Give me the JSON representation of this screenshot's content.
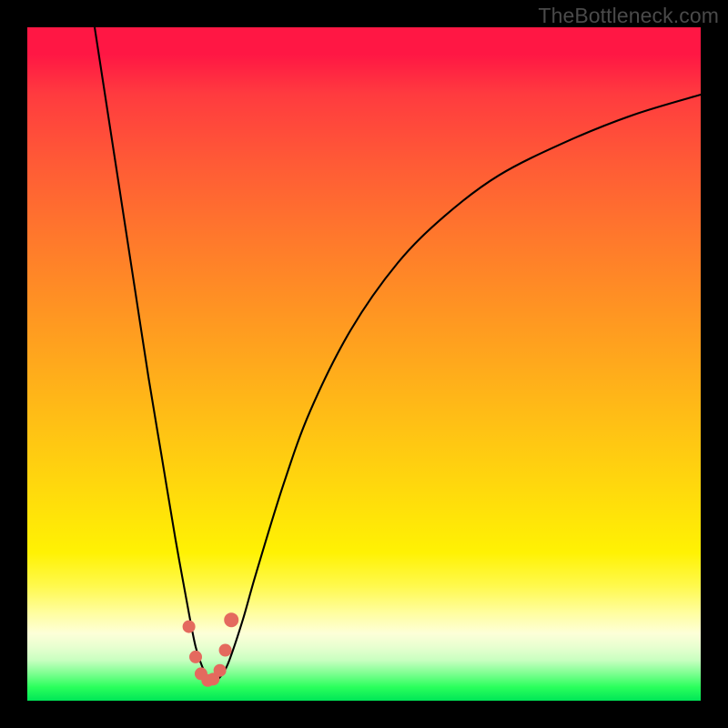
{
  "watermark": "TheBottleneck.com",
  "chart_data": {
    "type": "line",
    "title": "",
    "xlabel": "",
    "ylabel": "",
    "xlim": [
      0,
      100
    ],
    "ylim": [
      0,
      100
    ],
    "grid": false,
    "series": [
      {
        "name": "bottleneck-curve",
        "x": [
          10,
          12,
          14,
          16,
          18,
          20,
          22,
          24,
          25,
          26,
          27,
          28,
          29,
          30,
          32,
          34,
          38,
          42,
          48,
          55,
          62,
          70,
          80,
          90,
          100
        ],
        "values": [
          100,
          87,
          74,
          61,
          48,
          36,
          24,
          13,
          8,
          5,
          3,
          3,
          4,
          6,
          12,
          19,
          32,
          43,
          55,
          65,
          72,
          78,
          83,
          87,
          90
        ]
      }
    ],
    "markers": {
      "name": "highlight-points",
      "color": "#e46a5e",
      "x": [
        24.0,
        25.0,
        25.8,
        26.8,
        27.6,
        28.6,
        29.4,
        30.3
      ],
      "y": [
        11.0,
        6.5,
        4.0,
        3.0,
        3.2,
        4.5,
        7.5,
        12.0
      ],
      "r": [
        7,
        7,
        7,
        7,
        7,
        7,
        7,
        8
      ]
    },
    "background_gradient_stops": [
      {
        "pos": 0.0,
        "color": "#ff1744"
      },
      {
        "pos": 0.5,
        "color": "#ffa91c"
      },
      {
        "pos": 0.8,
        "color": "#fff203"
      },
      {
        "pos": 0.92,
        "color": "#e8ffd0"
      },
      {
        "pos": 1.0,
        "color": "#00e657"
      }
    ]
  }
}
